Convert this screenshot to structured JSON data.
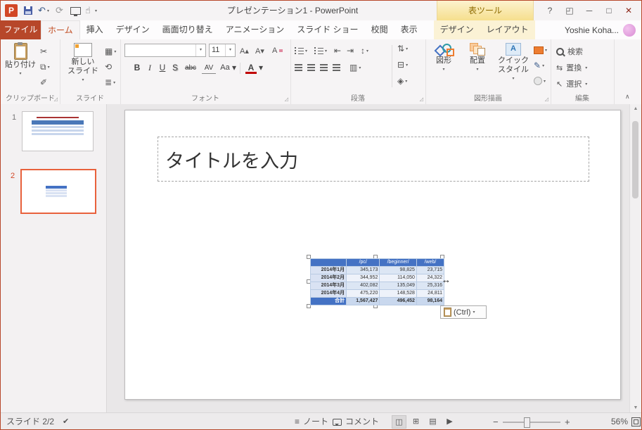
{
  "window": {
    "title": "プレゼンテーション1 - PowerPoint",
    "contextual_tool": "表ツール",
    "user_name": "Yoshie Koha..."
  },
  "tabs": [
    {
      "label": "ファイル"
    },
    {
      "label": "ホーム"
    },
    {
      "label": "挿入"
    },
    {
      "label": "デザイン"
    },
    {
      "label": "画面切り替え"
    },
    {
      "label": "アニメーション"
    },
    {
      "label": "スライド ショー"
    },
    {
      "label": "校閲"
    },
    {
      "label": "表示"
    },
    {
      "label": "デザイン"
    },
    {
      "label": "レイアウト"
    }
  ],
  "ribbon": {
    "clipboard": {
      "label": "クリップボード",
      "paste": "貼り付け"
    },
    "slides": {
      "label": "スライド",
      "new_slide_1": "新しい",
      "new_slide_2": "スライド"
    },
    "font": {
      "label": "フォント",
      "name_value": "",
      "size_value": "11",
      "bold": "B",
      "italic": "I",
      "underline": "U",
      "shadow": "S",
      "strikethrough": "abc",
      "spacing": "AV",
      "case": "Aa",
      "color": "A"
    },
    "paragraph": {
      "label": "段落"
    },
    "drawing": {
      "label": "図形描画",
      "shapes": "図形",
      "arrange": "配置",
      "quick_1": "クイック",
      "quick_2": "スタイル"
    },
    "editing": {
      "label": "編集",
      "find": "検索",
      "replace": "置換",
      "select": "選択"
    }
  },
  "thumbnails": [
    {
      "number": "1"
    },
    {
      "number": "2"
    }
  ],
  "slide": {
    "title_placeholder": "タイトルを入力",
    "table": {
      "headers": [
        "",
        "/pc/",
        "/beginner/",
        "/web/"
      ],
      "rows": [
        [
          "2014年1月",
          "345,173",
          "98,825",
          "23,715"
        ],
        [
          "2014年2月",
          "344,952",
          "114,050",
          "24,322"
        ],
        [
          "2014年3月",
          "402,082",
          "135,049",
          "25,316"
        ],
        [
          "2014年4月",
          "475,220",
          "148,528",
          "24,811"
        ],
        [
          "合計",
          "1,567,427",
          "496,452",
          "98,164"
        ]
      ]
    },
    "paste_options": "(Ctrl)"
  },
  "status_bar": {
    "slide_indicator": "スライド 2/2",
    "notes": "ノート",
    "comments": "コメント",
    "zoom": "56%"
  },
  "icons": {
    "logo": "P",
    "undo": "↶",
    "redo": "⟳",
    "touch": "☝",
    "help": "?",
    "ribbon_display": "◰",
    "minimize": "─",
    "maximize": "□",
    "close": "✕",
    "cut": "✂",
    "copy": "⧉",
    "format_painter": "✐",
    "layout": "▦",
    "reset": "⟲",
    "section": "≣",
    "grow_font": "A▴",
    "shrink_font": "A▾",
    "clear_format": "A",
    "outdent": "⇤",
    "indent": "⇥",
    "line_spacing": "↕",
    "columns": "▥",
    "text_direction": "⇅",
    "align_text": "⊟",
    "smartart": "◈",
    "quick_a": "A",
    "pen": "✎",
    "replace": "⇆",
    "select": "↖",
    "dropdown": "▼",
    "dropdown_small": "▾",
    "launcher": "◿",
    "collapse": "∧",
    "scroll_up": "▲",
    "scroll_down": "▼",
    "notes": "≡",
    "spell": "✔",
    "view_normal": "◫",
    "view_sorter": "⊞",
    "view_reading": "▤",
    "view_slideshow": "▶",
    "zoom_out": "−",
    "zoom_in": "+",
    "resize": "↔"
  },
  "colors": {
    "accent_red": "#B7472A",
    "tab_active_orange": "#C14C21",
    "contextual_yellow": "#F6DF8D",
    "thumb_selected_orange": "#E8613C",
    "table_header_blue": "#4472C4"
  }
}
